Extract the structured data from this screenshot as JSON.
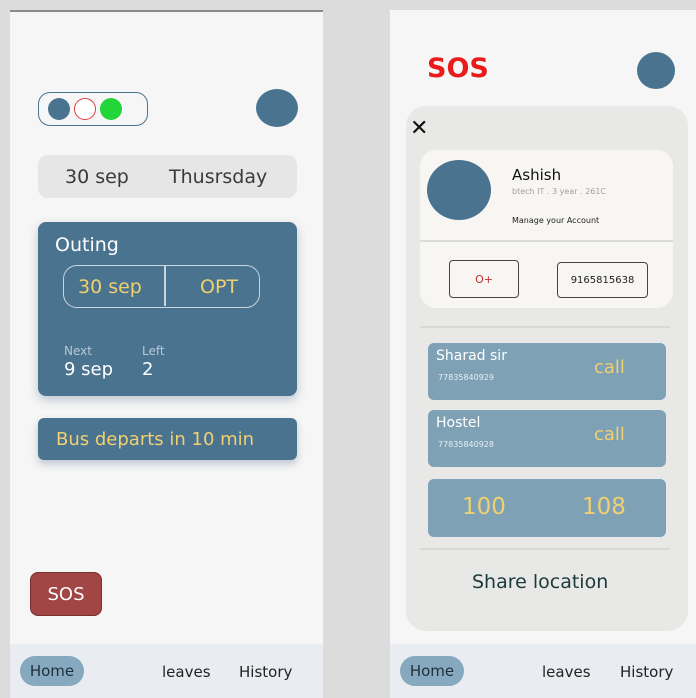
{
  "left": {
    "date": {
      "day": "30 sep",
      "weekday": "Thusrsday"
    },
    "outing": {
      "title": "Outing",
      "date": "30 sep",
      "option": "OPT",
      "next_label": "Next",
      "next_value": "9 sep",
      "left_label": "Left",
      "left_value": "2"
    },
    "bus": {
      "text": "Bus departs in  10 min"
    },
    "sos_button": "SOS",
    "nav": {
      "home": "Home",
      "leaves": "leaves",
      "history": "History"
    }
  },
  "right": {
    "title": "SOS",
    "close": "✕",
    "profile": {
      "name": "Ashish",
      "subtitle": "btech IT  .   3 year  .  261C",
      "manage": "Manage your Account",
      "blood_group": "O+",
      "phone": "9165815638"
    },
    "contacts": [
      {
        "name": "Sharad sir",
        "number": "77835840929",
        "action": "call"
      },
      {
        "name": "Hostel",
        "number": "77835840928",
        "action": "call"
      }
    ],
    "emergency": {
      "police": "100",
      "ambulance": "108"
    },
    "share_location": "Share location",
    "nav": {
      "home": "Home",
      "leaves": "leaves",
      "history": "History"
    }
  },
  "colors": {
    "primary": "#4a7390",
    "accent_text": "#f0d070",
    "sos_red": "#e81c1c",
    "sos_button": "#a14545",
    "contact_card": "#7ea1b6"
  }
}
